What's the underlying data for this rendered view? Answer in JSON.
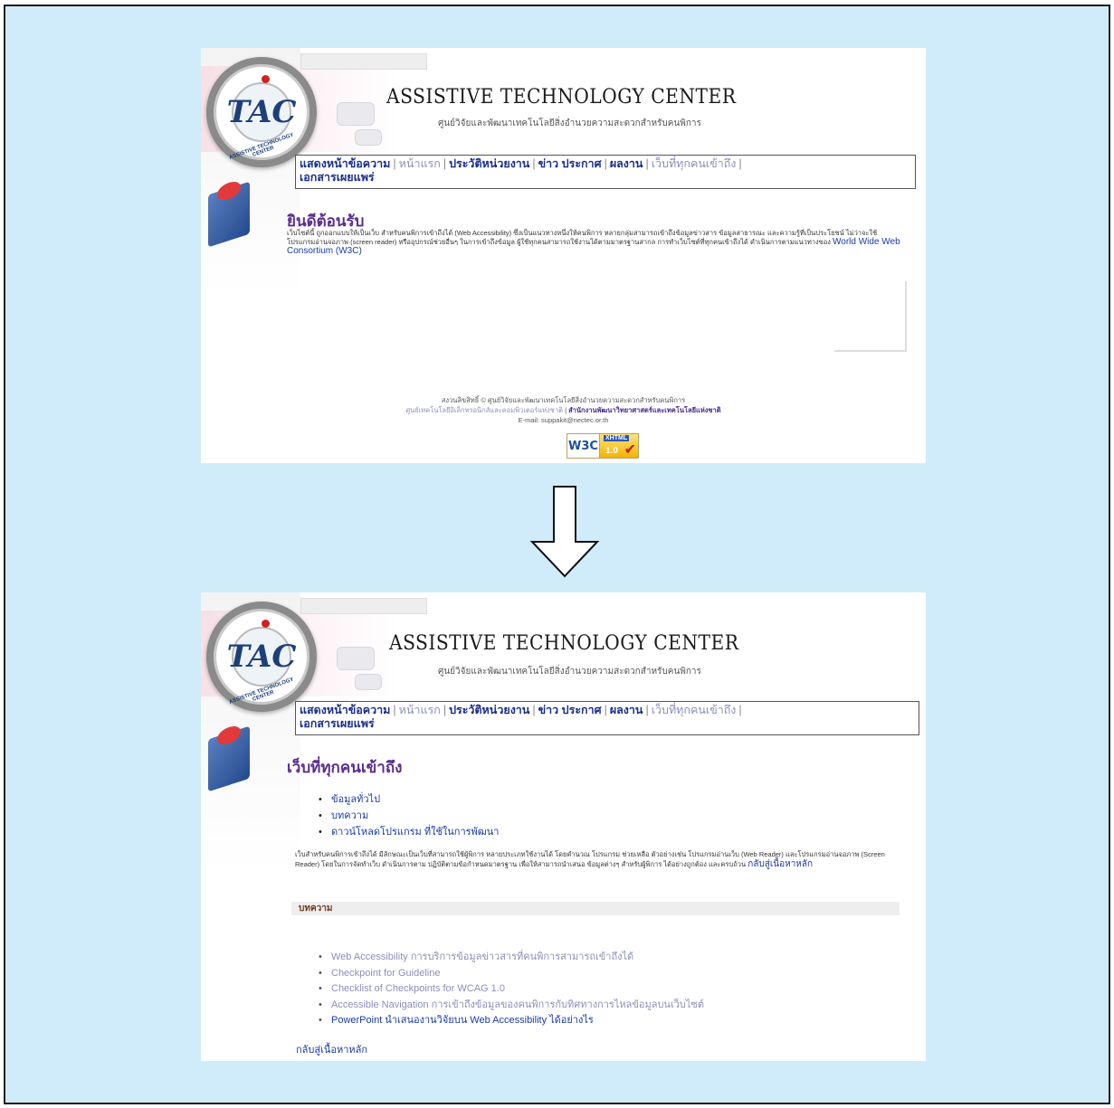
{
  "site": {
    "title": "ASSISTIVE TECHNOLOGY CENTER",
    "subtitle": "ศูนย์วิจัยและพัฒนาเทคโนโลยีสิ่งอำนวยความสะดวกสำหรับคนพิการ",
    "logo_letters": "TAC",
    "logo_ring_text": "ASSISTIVE TECHNOLOGY CENTER"
  },
  "nav": {
    "items": [
      {
        "label": "แสดงหน้าข้อความ",
        "style": "bold"
      },
      {
        "label": "หน้าแรก",
        "style": "light"
      },
      {
        "label": "ประวัติหน่วยงาน",
        "style": "bold"
      },
      {
        "label": "ข่าว ประกาศ",
        "style": "bold"
      },
      {
        "label": "ผลงาน",
        "style": "bold"
      },
      {
        "label": "เว็บที่ทุกคนเข้าถึง",
        "style": "light"
      },
      {
        "label": "เอกสารเผยแพร่",
        "style": "bold"
      }
    ],
    "separator": "|"
  },
  "before": {
    "heading": "ยินดีต้อนรับ",
    "intro_text": "เว็บไซต์นี้ ถูกออกแบบให้เป็นเว็บ สำหรับคนพิการเข้าถึงได้ (Web Accessibility) ซึ่งเป็นแนวทางหนึ่งให้คนพิการ หลายกลุ่มสามารถเข้าถึงข้อมูลข่าวสาร ข้อมูลสาธารณะ และความรู้ที่เป็นประโยชน์ ไม่ว่าจะใช้โปรแกรมอ่านจอภาพ (screen reader) หรืออุปกรณ์ช่วยอื่นๆ ในการเข้าถึงข้อมูล ผู้ใช้ทุกคนสามารถใช้งานได้ตามมาตรฐานสากล การทำเว็บไซต์ที่ทุกคนเข้าถึงได้ ดำเนินการตามแนวทางของ",
    "intro_link": "World Wide Web Consortium (W3C)",
    "footer_line1": "สงวนลิขสิทธิ์ © ศูนย์วิจัยและพัฒนาเทคโนโลยีสิ่งอำนวยความสะดวกสำหรับคนพิการ",
    "footer_link1": "ศูนย์เทคโนโลยีอิเล็กทรอนิกส์และคอมพิวเตอร์แห่งชาติ",
    "footer_link2": "สำนักงานพัฒนาวิทยาศาสตร์และเทคโนโลยีแห่งชาติ",
    "footer_email": "E-mail: suppakit@nectec.or.th",
    "badge_w3c": "W3C",
    "badge_xhtml": "XHTML",
    "badge_version": "1.0"
  },
  "after": {
    "heading": "เว็บที่ทุกคนเข้าถึง",
    "menu": [
      "ข้อมูลทั่วไป",
      "บทความ",
      "ดาวน์โหลดโปรแกรม ที่ใช้ในการพัฒนา"
    ],
    "body_text": "เว็บสำหรับคนพิการเข้าถึงได้ มีลักษณะเป็นเว็บที่สามารถใช้ผู้พิการ หลายประเภทใช้งานได้ โดยคำนวณ โปรแกรม ช่วยเหลือ ตัวอย่างเช่น โปรแกรมอ่านเว็บ (Web Reader) และโปรแกรมอ่านจอภาพ (Screen Reader) โดยในการจัดทำเว็บ ดำเนินการตาม ปฏิบัติตามข้อกำหนดมาตรฐาน เพื่อให้สามารถนำเสนอ ข้อมูลต่างๆ สำหรับผู้พิการ ได้อย่างถูกต้อง และครบถ้วน",
    "back_link_inline": "กลับสู่เนื้อหาหลัก",
    "section_title": "บทความ",
    "articles": [
      {
        "label": "Web Accessibility การบริการข้อมูลข่าวสารที่คนพิการสามารถเข้าถึงได้",
        "visited": true
      },
      {
        "label": "Checkpoint for Guideline",
        "visited": true
      },
      {
        "label": "Checklist of Checkpoints for WCAG 1.0",
        "visited": true
      },
      {
        "label": "Accessible Navigation การเข้าถึงข้อมูลของคนพิการกับทิศทางการไหลข้อมูลบนเว็บไซต์",
        "visited": true
      },
      {
        "label": "PowerPoint นำเสนองานวิจัยบน Web Accessibility ได้อย่างไร",
        "visited": false
      }
    ],
    "back_link": "กลับสู่เนื้อหาหลัก"
  },
  "colors": {
    "background": "#d0ecfb",
    "nav_bold": "#1a2f8a",
    "nav_light": "#8a8fb8",
    "heading": "#5a2d8e",
    "link": "#1a3aa8",
    "visited": "#8a8fb8"
  }
}
